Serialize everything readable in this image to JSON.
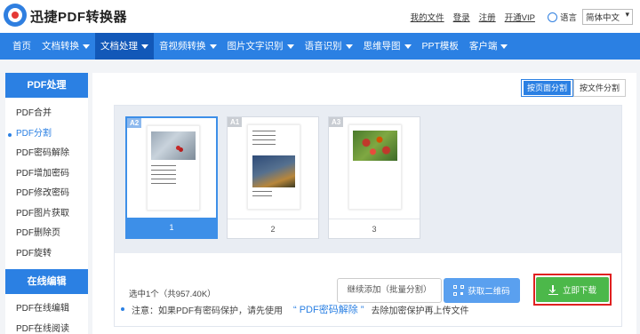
{
  "header": {
    "logo_text": "迅捷PDF转换器",
    "links": [
      "我的文件",
      "登录",
      "注册",
      "开通VIP"
    ],
    "lang_label": "语言",
    "lang_value": "简体中文"
  },
  "nav": {
    "items": [
      {
        "label": "首页",
        "caret": false
      },
      {
        "label": "文档转换",
        "caret": true
      },
      {
        "label": "文档处理",
        "caret": true,
        "active": true
      },
      {
        "label": "音视频转换",
        "caret": true
      },
      {
        "label": "图片文字识别",
        "caret": true
      },
      {
        "label": "语音识别",
        "caret": true
      },
      {
        "label": "思维导图",
        "caret": true
      },
      {
        "label": "PPT模板",
        "caret": false
      },
      {
        "label": "客户端",
        "caret": true
      }
    ]
  },
  "sidebar": {
    "section1_title": "PDF处理",
    "section1_items": [
      "PDF合并",
      "PDF分割",
      "PDF密码解除",
      "PDF增加密码",
      "PDF修改密码",
      "PDF图片获取",
      "PDF删除页",
      "PDF旋转"
    ],
    "active_item": "PDF分割",
    "section2_title": "在线编辑",
    "section2_items": [
      "PDF在线编辑",
      "PDF在线阅读"
    ]
  },
  "main": {
    "mode_active": "按页面分割",
    "mode_other": "按文件分割",
    "pages": [
      {
        "tag": "A2",
        "number": "1",
        "selected": true
      },
      {
        "tag": "A1",
        "number": "2",
        "selected": false
      },
      {
        "tag": "A3",
        "number": "3",
        "selected": false
      }
    ],
    "selection_info": "选中1个（共957.40K）",
    "add_button": "继续添加（批量分割）",
    "qr_button": "获取二维码",
    "download_button": "立即下载",
    "notice_prefix": "注意：如果PDF有密码保护，请先使用",
    "notice_link": "“ PDF密码解除 ”",
    "notice_suffix": "去除加密保护再上传文件"
  },
  "colors": {
    "primary": "#2b80e3",
    "nav_active": "#1258b8",
    "download_green": "#4cb84a",
    "highlight_red": "#e02020"
  }
}
